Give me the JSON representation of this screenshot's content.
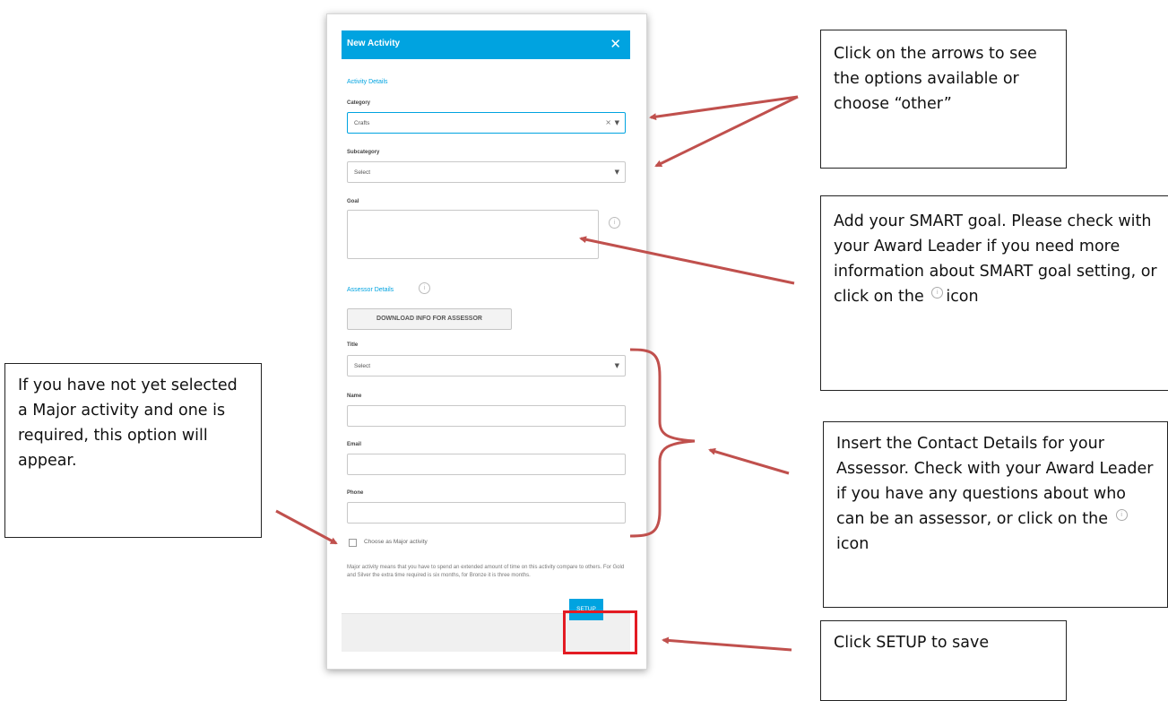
{
  "modal": {
    "title": "New Activity",
    "close_icon": "close-icon",
    "activity_details": "Activity Details",
    "category": {
      "label": "Category",
      "value": "Crafts"
    },
    "subcategory": {
      "label": "Subcategory",
      "value": "Select"
    },
    "goal": {
      "label": "Goal",
      "value": ""
    },
    "assessor_details": "Assessor Details",
    "download_button": "DOWNLOAD INFO FOR ASSESSOR",
    "title_field": {
      "label": "Title",
      "value": "Select"
    },
    "name_field": {
      "label": "Name",
      "value": ""
    },
    "email_field": {
      "label": "Email",
      "value": ""
    },
    "phone_field": {
      "label": "Phone",
      "value": ""
    },
    "major_checkbox": "Choose as Major activity",
    "help_text": "Major activity means that you have to spend an extended amount of time on this activity compare to others. For Gold and Silver the extra time required is six months, for Bronze it is three months.",
    "setup_button": "SETUP",
    "info_glyph": "i"
  },
  "callouts": {
    "arrows": "Click on the arrows to see the options available or choose “other”",
    "goal_part1": "Add your SMART goal. Please check with your Award Leader if you need more information about SMART goal setting, or click on the",
    "goal_part2": "icon",
    "assessor_part1": "Insert the Contact Details for your Assessor. Check with your Award Leader if you have any questions about who can be an assessor, or click on the",
    "assessor_part2": "icon",
    "major": "If you have not yet selected a Major activity and one is required, this option will appear.",
    "setup": "Click SETUP to save"
  },
  "colors": {
    "accent": "#00a3e0",
    "arrow": "#c0504d",
    "highlight": "#e31b23"
  }
}
